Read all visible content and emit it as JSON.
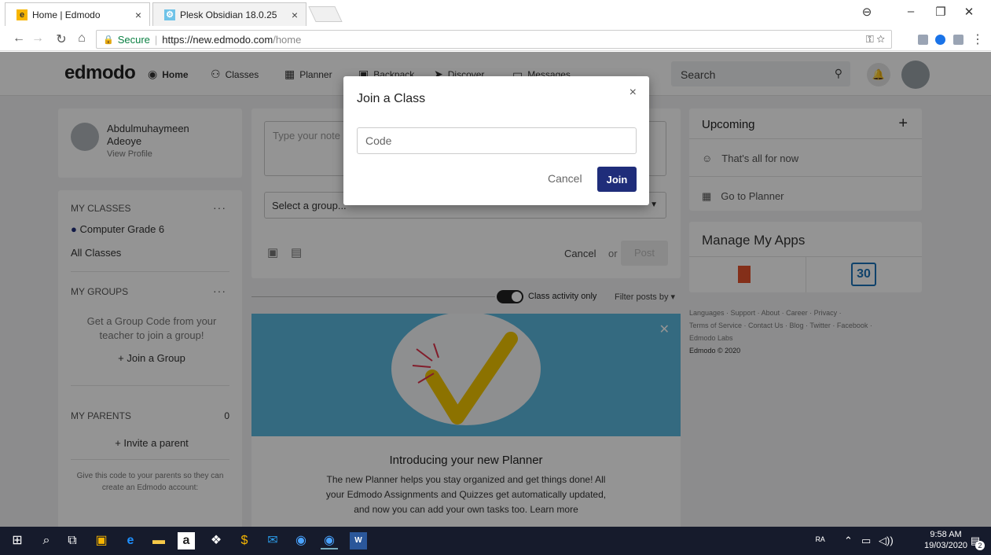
{
  "browser": {
    "tabs": [
      {
        "title": "Home | Edmodo",
        "favicon": "edmodo-icon",
        "close": "×"
      },
      {
        "title": "Plesk Obsidian 18.0.25",
        "favicon": "plesk-icon",
        "close": "×"
      }
    ],
    "secure_label": "Secure",
    "url_host": "https://new.edmodo.com",
    "url_path": "/home"
  },
  "topbar": {
    "logo": "edmodo",
    "nav": [
      "Home",
      "Classes",
      "Planner",
      "Backpack",
      "Discover",
      "Messages"
    ],
    "search_placeholder": "Search"
  },
  "profile": {
    "first_name": "Abdulmuhaymeen",
    "last_name": "Adeoye",
    "link": "View Profile"
  },
  "classes": {
    "heading": "MY CLASSES",
    "items": [
      "Computer Grade 6"
    ],
    "all": "All Classes"
  },
  "groups": {
    "heading": "MY GROUPS",
    "hint": "Get a Group Code from your teacher to join a group!",
    "join": "+ Join a Group"
  },
  "parents": {
    "heading": "MY PARENTS",
    "count": "0",
    "invite": "+ Invite a parent",
    "hint": "Give this code to your parents so they can create an Edmodo account:"
  },
  "post": {
    "placeholder": "Type your note",
    "select": "Select a group...",
    "cancel": "Cancel",
    "or": "or",
    "submit": "Post"
  },
  "feed": {
    "toggle_label": "Class activity only",
    "filter": "Filter posts by"
  },
  "planner_promo": {
    "title": "Introducing your new Planner",
    "body1": "The new Planner helps you stay organized and get things done! All",
    "body2": "your Edmodo Assignments and Quizzes get automatically updated,",
    "body3": "and now you can add your own tasks too. Learn more"
  },
  "upcoming": {
    "heading": "Upcoming",
    "add": "+",
    "empty": "That's all for now",
    "planner": "Go to Planner"
  },
  "apps": {
    "heading": "Manage My Apps",
    "calendar_day": "30"
  },
  "footer": {
    "line1": "Languages · Support · About · Career · Privacy ·",
    "line2": "Terms of Service · Contact Us · Blog · Twitter · Facebook ·",
    "line3": "Edmodo Labs",
    "line4": "Edmodo © 2020"
  },
  "modal": {
    "title": "Join a Class",
    "close": "×",
    "input_placeholder": "Code",
    "cancel": "Cancel",
    "join": "Join"
  },
  "taskbar": {
    "time": "9:58 AM",
    "date": "19/03/2020",
    "notifications": "2"
  }
}
